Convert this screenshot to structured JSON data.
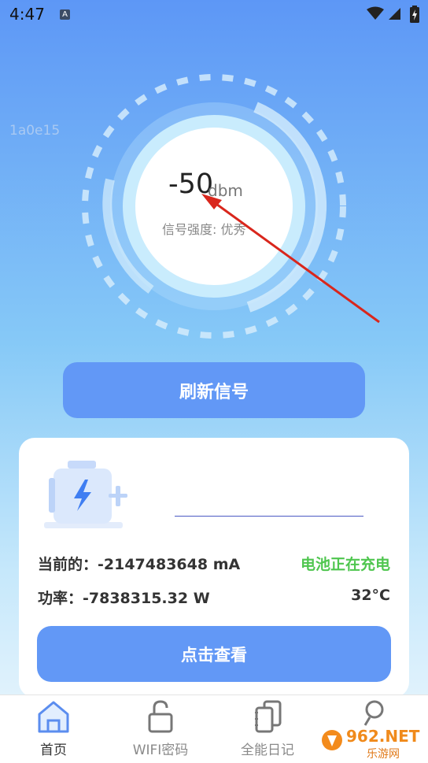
{
  "status_bar": {
    "time": "4:47",
    "notification_glyph": "A"
  },
  "overlay_text": "1a0e15",
  "signal": {
    "value": "-50",
    "unit": "dbm",
    "strength_label": "信号强度: 优秀"
  },
  "refresh_button": "刷新信号",
  "battery": {
    "current_text": "当前的：-2147483648 mA",
    "status_text": "电池正在充电",
    "power_text": "功率：-7838315.32 W",
    "temperature": "32°C"
  },
  "view_button": "点击查看",
  "tabs": [
    {
      "label": "首页",
      "icon": "home-icon",
      "active": true
    },
    {
      "label": "WIFI密码",
      "icon": "lock-icon",
      "active": false
    },
    {
      "label": "全能日记",
      "icon": "notebook-icon",
      "active": false
    },
    {
      "label": "",
      "icon": "search-person-icon",
      "active": false
    }
  ],
  "watermark": {
    "text": "962.NET",
    "subtext": "乐游网"
  },
  "colors": {
    "accent": "#6298f6",
    "charging": "#4fc64f",
    "annotation_arrow": "#d9261c"
  }
}
